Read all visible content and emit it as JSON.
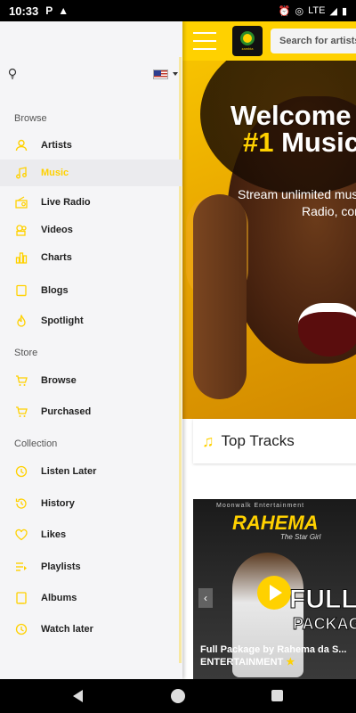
{
  "status_bar": {
    "time": "10:33",
    "network": "LTE"
  },
  "header": {
    "search_placeholder": "Search for artists, "
  },
  "hero": {
    "welcome": "Welcome",
    "number": "#1",
    "music": "Music",
    "stream_line1": "Stream unlimited musi",
    "stream_line2": "Radio, con"
  },
  "top_tracks": {
    "title": "Top Tracks"
  },
  "featured_album": {
    "label": "Moonwalk Entertainment",
    "artist": "RAHEMA",
    "subtitle": "The Star Girl",
    "title_big": "FULL",
    "title_big2": "PACKAGE",
    "caption_line1": "Full Package by Rahema da S...",
    "caption_line2": "ENTERTAINMENT"
  },
  "drawer": {
    "sections": {
      "browse": "Browse",
      "store": "Store",
      "collection": "Collection"
    },
    "browse_items": [
      {
        "label": "Artists",
        "icon": "person-icon"
      },
      {
        "label": "Music",
        "icon": "music-note-icon",
        "active": true
      },
      {
        "label": "Live Radio",
        "icon": "radio-icon"
      },
      {
        "label": "Videos",
        "icon": "film-reel-icon"
      },
      {
        "label": "Charts",
        "icon": "bar-chart-icon"
      },
      {
        "label": "Blogs",
        "icon": "document-icon"
      },
      {
        "label": "Spotlight",
        "icon": "flame-icon"
      }
    ],
    "store_items": [
      {
        "label": "Browse",
        "icon": "cart-icon"
      },
      {
        "label": "Purchased",
        "icon": "cart-check-icon"
      }
    ],
    "collection_items": [
      {
        "label": "Listen Later",
        "icon": "clock-icon"
      },
      {
        "label": "History",
        "icon": "history-icon"
      },
      {
        "label": "Likes",
        "icon": "heart-icon"
      },
      {
        "label": "Playlists",
        "icon": "playlist-icon"
      },
      {
        "label": "Albums",
        "icon": "album-icon"
      },
      {
        "label": "Watch later",
        "icon": "clock-icon"
      }
    ]
  },
  "colors": {
    "accent": "#ffd100",
    "drawer_bg": "#f5f5f7",
    "active_bg": "#ebebee"
  }
}
